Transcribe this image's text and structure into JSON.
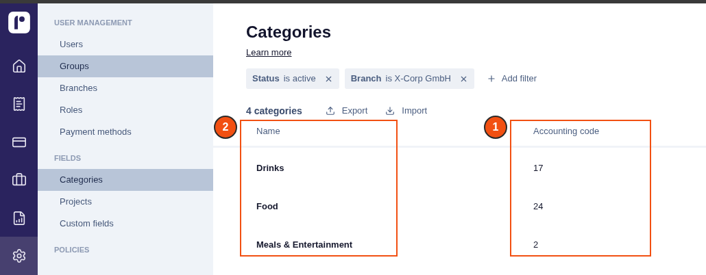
{
  "rail": {
    "items": [
      {
        "kind": "home",
        "selected": false
      },
      {
        "kind": "receipt",
        "selected": false
      },
      {
        "kind": "card",
        "selected": false
      },
      {
        "kind": "briefcase",
        "selected": false
      },
      {
        "kind": "report",
        "selected": false
      },
      {
        "kind": "settings",
        "selected": true
      }
    ]
  },
  "sidebar": {
    "sections": [
      {
        "title": "USER MANAGEMENT",
        "items": [
          {
            "label": "Users",
            "selected": false
          },
          {
            "label": "Groups",
            "selected": true
          },
          {
            "label": "Branches",
            "selected": false
          },
          {
            "label": "Roles",
            "selected": false
          },
          {
            "label": "Payment methods",
            "selected": false
          }
        ]
      },
      {
        "title": "FIELDS",
        "items": [
          {
            "label": "Categories",
            "selected": true
          },
          {
            "label": "Projects",
            "selected": false
          },
          {
            "label": "Custom fields",
            "selected": false
          }
        ]
      },
      {
        "title": "POLICIES"
      }
    ]
  },
  "page": {
    "title": "Categories",
    "link": "Learn more"
  },
  "filters": [
    {
      "field": "Status",
      "value": "is active"
    },
    {
      "field": "Branch",
      "value": "is X-Corp GmbH"
    }
  ],
  "add_filter": "Add filter",
  "toolbar": {
    "count": "4 categories",
    "export": "Export",
    "import": "Import"
  },
  "table": {
    "columns": [
      {
        "header": "Name",
        "badge": "2",
        "cells": [
          "Drinks",
          "Food",
          "Meals & Entertainment"
        ]
      },
      {
        "header": "Accounting code",
        "badge": "1",
        "cells": [
          "17",
          "24",
          "2"
        ]
      }
    ]
  }
}
